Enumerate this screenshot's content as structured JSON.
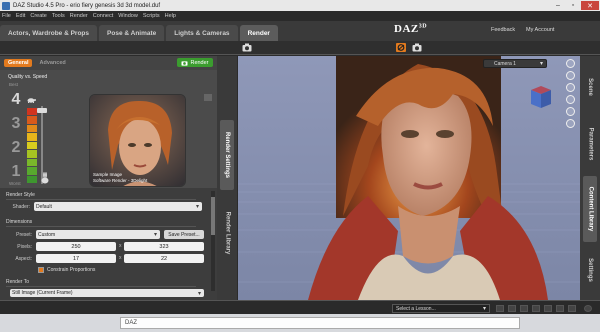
{
  "window": {
    "title": "DAZ Studio 4.5 Pro - erio fiery genesis 3d 3d model.duf"
  },
  "menu": [
    "File",
    "Edit",
    "Create",
    "Tools",
    "Render",
    "Connect",
    "Window",
    "Scripts",
    "Help"
  ],
  "rooms": {
    "tabs": [
      "Actors, Wardrobe & Props",
      "Pose & Animate",
      "Lights & Cameras",
      "Render"
    ],
    "active": "Render"
  },
  "brand": {
    "logo_main": "DAZ",
    "logo_accent": "3D"
  },
  "top_links": {
    "feedback": "Feedback",
    "my_account": "My Account"
  },
  "render_pane": {
    "tabs": {
      "general": "General",
      "advanced": "Advanced"
    },
    "render_button": "Render",
    "quality_label": "Quality vs. Speed",
    "best_label": "Best",
    "worst_label": "Worst",
    "levels": [
      "4",
      "3",
      "2",
      "1"
    ],
    "current_level": "4",
    "meter_colors": [
      "#d1341f",
      "#d85a1c",
      "#e18a1a",
      "#e7b51b",
      "#d8cc1e",
      "#a6c322",
      "#7ab82a",
      "#58a92e",
      "#3e962f"
    ],
    "preview_caption_line1": "Sample Image",
    "preview_caption_line2": "Software Render - 3Delight"
  },
  "settings": {
    "render_style_label": "Render Style",
    "shader_label": "Shader:",
    "shader_value": "Default",
    "dimensions_label": "Dimensions",
    "preset_label": "Preset:",
    "preset_value": "Custom",
    "save_preset_button": "Save Preset...",
    "pixels_label": "Pixels:",
    "pixels_width": "250",
    "pixels_height": "323",
    "aspect_label": "Aspect:",
    "aspect_width": "17",
    "aspect_height": "22",
    "x_sep": "x",
    "constrain_label": "Constrain Proportions",
    "render_to_label": "Render To",
    "render_to_value": "Still Image (Current Frame)"
  },
  "side_tabs_left": [
    "Render Settings",
    "Render Library"
  ],
  "side_tabs_right": [
    "Scene",
    "Parameters",
    "Content Library",
    "Settings"
  ],
  "viewport": {
    "camera_value": "Camera 1"
  },
  "bottom": {
    "lesson_placeholder": "Select a Lesson...",
    "taskbar_text": "DAZ"
  },
  "colors": {
    "accent_orange": "#e27a1e",
    "render_green": "#3b9c2f",
    "viewport_bg": "#8a94b4"
  }
}
